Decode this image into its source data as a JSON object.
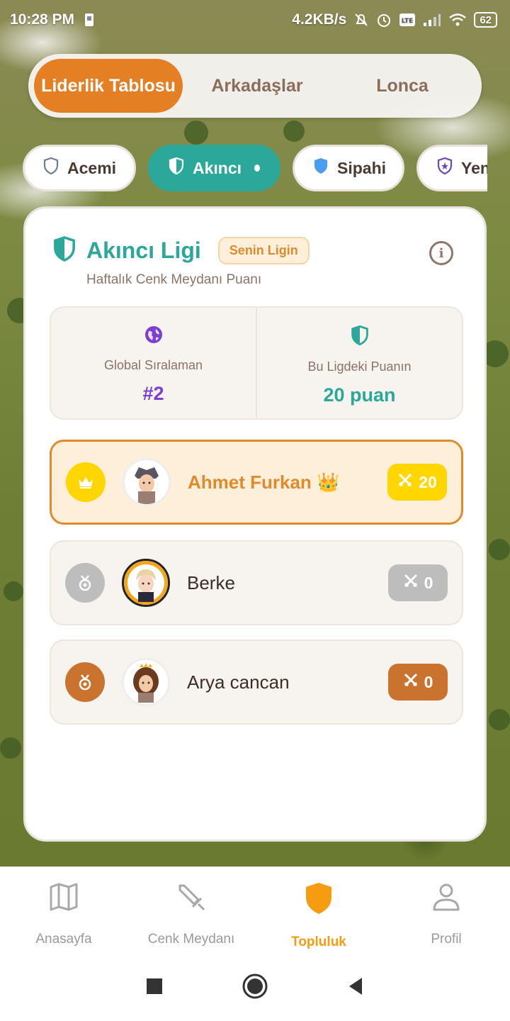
{
  "status_bar": {
    "time": "10:28 PM",
    "network_speed": "4.2KB/s",
    "battery": "62"
  },
  "top_tabs": [
    {
      "label": "Liderlik Tablosu",
      "active": true
    },
    {
      "label": "Arkadaşlar",
      "active": false
    },
    {
      "label": "Lonca",
      "active": false
    }
  ],
  "leagues": [
    {
      "label": "Acemi",
      "icon": "shield-outline-icon",
      "active": false
    },
    {
      "label": "Akıncı",
      "icon": "shield-half-icon",
      "active": true
    },
    {
      "label": "Sipahi",
      "icon": "shield-filled-blue-icon",
      "active": false
    },
    {
      "label": "Yeniçeri",
      "icon": "shield-star-icon",
      "active": false
    }
  ],
  "card": {
    "title": "Akıncı Ligi",
    "your_league_badge": "Senin Ligin",
    "subtitle": "Haftalık Cenk Meydanı Puanı",
    "stats": {
      "global_rank_label": "Global Sıralaman",
      "global_rank_value": "#2",
      "league_points_label": "Bu Ligdeki Puanın",
      "league_points_value": "20 puan"
    },
    "players": [
      {
        "name": "Ahmet Furkan 👑",
        "score": "20",
        "rank_icon": "crown-icon",
        "is_me": true
      },
      {
        "name": "Berke",
        "score": "0",
        "rank_icon": "medal-icon",
        "is_me": false
      },
      {
        "name": "Arya cancan",
        "score": "0",
        "rank_icon": "medal-icon",
        "is_me": false
      }
    ]
  },
  "bottom_nav": [
    {
      "label": "Anasayfa",
      "icon": "map-icon",
      "active": false
    },
    {
      "label": "Cenk Meydanı",
      "icon": "sword-icon",
      "active": false
    },
    {
      "label": "Topluluk",
      "icon": "shield-icon",
      "active": true
    },
    {
      "label": "Profil",
      "icon": "user-icon",
      "active": false
    }
  ],
  "colors": {
    "accent_orange": "#e57f24",
    "teal": "#2ba89a",
    "gold": "#ffd600",
    "silver": "#bdbdbd",
    "bronze": "#c9732f",
    "purple": "#7c3fd0"
  }
}
